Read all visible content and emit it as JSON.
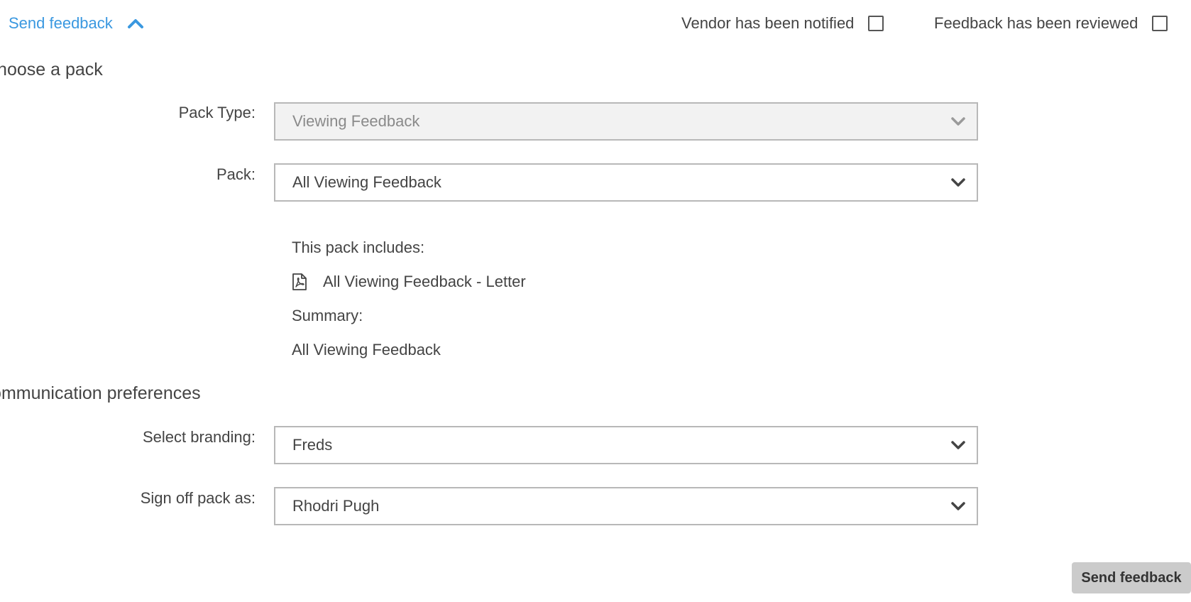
{
  "header": {
    "toggle_label": "Send feedback",
    "toggle_icon": "chevron-up-icon",
    "vendor_notified_label": "Vendor has been notified",
    "vendor_notified_checked": false,
    "feedback_reviewed_label": "Feedback has been reviewed",
    "feedback_reviewed_checked": false
  },
  "choose_pack": {
    "title": "Choose a pack",
    "pack_type": {
      "label": "Pack Type:",
      "value": "Viewing Feedback",
      "disabled": true
    },
    "pack": {
      "label": "Pack:",
      "value": "All Viewing Feedback"
    },
    "includes_label": "This pack includes:",
    "documents": [
      {
        "icon": "pdf-file-icon",
        "name": "All Viewing Feedback - Letter"
      }
    ],
    "summary_label": "Summary:",
    "summary_value": "All Viewing Feedback"
  },
  "communication": {
    "title": "Communication preferences",
    "branding": {
      "label": "Select branding:",
      "value": "Freds"
    },
    "sign_off": {
      "label": "Sign off pack as:",
      "value": "Rhodri Pugh"
    }
  },
  "actions": {
    "send_label": "Send feedback"
  },
  "colors": {
    "link": "#3a98e0",
    "text": "#444444",
    "border": "#b8b8b8",
    "disabled_bg": "#f2f2f2",
    "button_bg": "#cbcbcb"
  }
}
